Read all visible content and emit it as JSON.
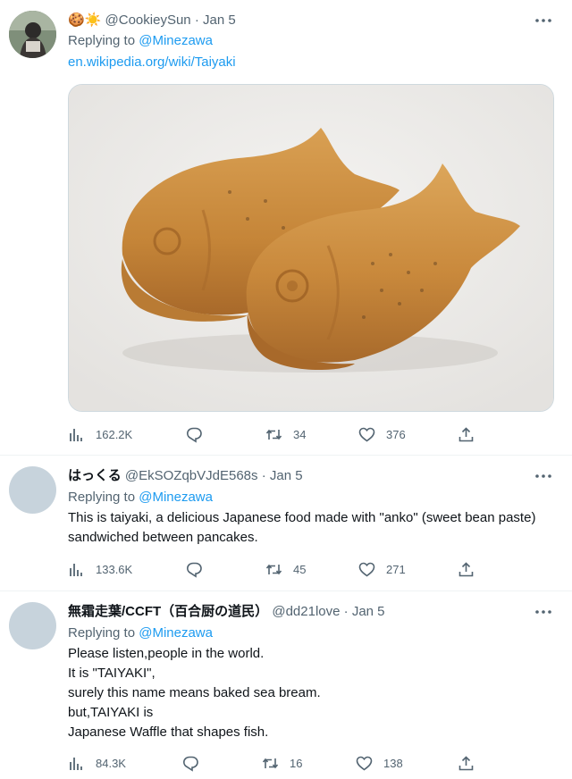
{
  "tweets": [
    {
      "emojis": "🍪☀️",
      "name": "",
      "handle": "@CookieySun",
      "date": "Jan 5",
      "replying_prefix": "Replying to",
      "replying_to": "@Minezawa",
      "link": "en.wikipedia.org/wiki/Taiyaki",
      "text": "",
      "views": "162.2K",
      "retweets": "34",
      "likes": "376",
      "has_image": true
    },
    {
      "name": "はっくる",
      "handle": "@EkSOZqbVJdE568s",
      "date": "Jan 5",
      "replying_prefix": "Replying to",
      "replying_to": "@Minezawa",
      "text": "This is taiyaki, a delicious Japanese food made with \"anko\" (sweet bean paste) sandwiched between pancakes.",
      "views": "133.6K",
      "retweets": "45",
      "likes": "271"
    },
    {
      "name": "無霜走葉/CCFT（百合厨の道民）",
      "handle": "@dd21love",
      "date": "Jan 5",
      "replying_prefix": "Replying to",
      "replying_to": "@Minezawa",
      "text": "Please listen,people in the world.\nIt is \"TAIYAKI\",\nsurely this name means baked sea bream.\nbut,TAIYAKI is\nJapanese Waffle that shapes fish.",
      "views": "84.3K",
      "retweets": "16",
      "likes": "138"
    }
  ],
  "separator": "·",
  "colors": {
    "link": "#1d9bf0",
    "muted": "#536471",
    "text": "#0f1419",
    "border": "#eff3f4"
  },
  "icons": [
    "more-icon",
    "views-icon",
    "reply-icon",
    "retweet-icon",
    "like-icon",
    "share-icon"
  ]
}
